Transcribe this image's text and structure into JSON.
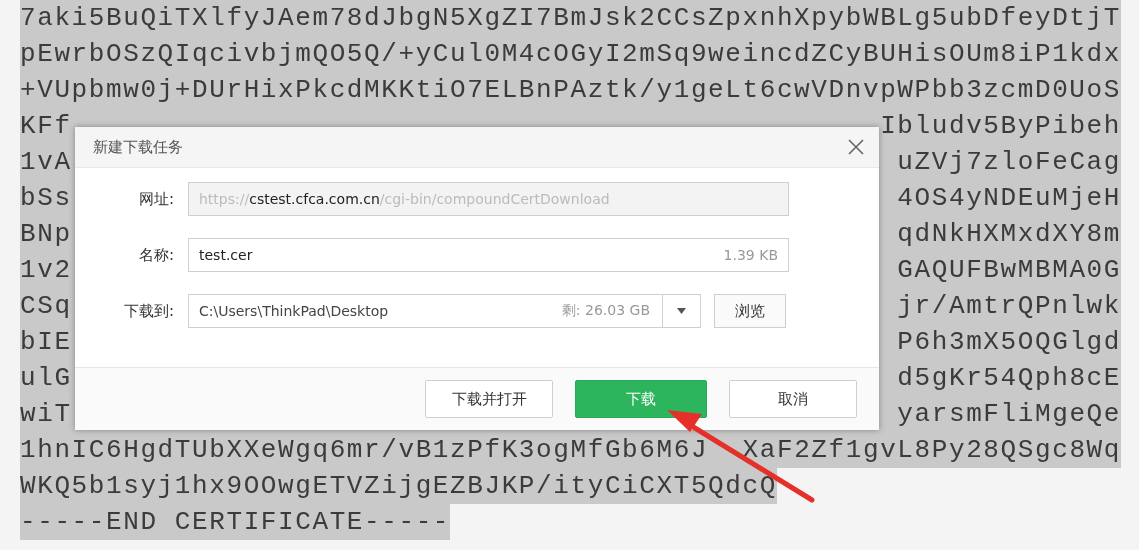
{
  "certificate_lines": [
    {
      "kind": "full",
      "text": "7aki5BuQiTXlfyJAem78dJbgN5XgZI7BmJsk2CCsZpxnhXpybWBLg5ubDfeyDtjT"
    },
    {
      "kind": "full",
      "text": "pEwrbOSzQIqcivbjmQO5Q/+yCul0M4cOGyI2mSq9weincdZCyBUHisOUm8iP1kdx"
    },
    {
      "kind": "full",
      "text": "+VUpbmw0j+DUrHixPkcdMKKtiO7ELBnPAztk/y1geLt6cwVDnvpWPbb3zcmD0UoS"
    },
    {
      "kind": "split",
      "left": "KFf",
      "right": "Ibludv5ByPibeh"
    },
    {
      "kind": "split",
      "left": "1vA",
      "right": "uZVj7zloFeCag"
    },
    {
      "kind": "split",
      "left": "bSs",
      "right": "4OS4yNDEuMjeH"
    },
    {
      "kind": "split",
      "left": "BNp",
      "right": "qdNkHXMxdXY8m"
    },
    {
      "kind": "split",
      "left": "1v2",
      "right": "GAQUFBwMBMA0G"
    },
    {
      "kind": "split",
      "left": "CSq",
      "right": "jr/AmtrQPnlwk"
    },
    {
      "kind": "split",
      "left": "bIE",
      "right": "P6h3mX5OQGlgd"
    },
    {
      "kind": "split",
      "left": "ulG",
      "right": "d5gKr54Qph8cE"
    },
    {
      "kind": "split",
      "left": "wiT",
      "right": "yarsmFliMgeQe"
    },
    {
      "kind": "split",
      "left": "1hnIC6HgdTUbXXeWgq6mr/vB1zPfK3ogMfGb6M6J",
      "right": "XaF2Zf1gvL8Py28QSgc8Wq"
    },
    {
      "kind": "full",
      "text": "WKQ5b1syj1hx9OOwgETVZijgEZBJKP/ityCiCXT5QdcQ"
    },
    {
      "kind": "full",
      "text": "-----END CERTIFICATE-----"
    }
  ],
  "dialog": {
    "title": "新建下载任务",
    "fields": [
      {
        "kind": "url",
        "label": "网址:",
        "scheme": "https://",
        "host": "cstest.cfca.com.cn",
        "path": "/cgi-bin/compoundCertDownload",
        "disabled": true
      },
      {
        "kind": "name",
        "label": "名称:",
        "value": "test.cer",
        "size": "1.39 KB"
      },
      {
        "kind": "folder",
        "label": "下载到:",
        "value": "C:\\Users\\ThinkPad\\Desktop",
        "free_space": "剩: 26.03 GB",
        "button": "浏览"
      }
    ],
    "buttons": [
      {
        "label": "下载并打开",
        "primary": false
      },
      {
        "label": "下载",
        "primary": true
      },
      {
        "label": "取消",
        "primary": false
      }
    ]
  }
}
